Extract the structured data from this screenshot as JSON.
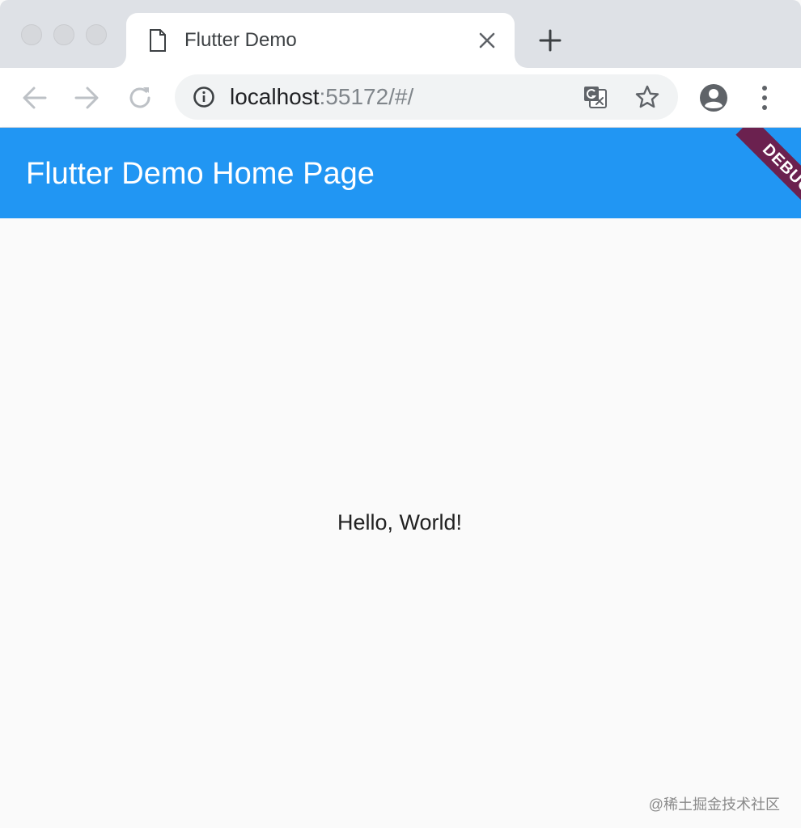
{
  "browser": {
    "tab": {
      "title": "Flutter Demo"
    },
    "address": {
      "host": "localhost",
      "rest": ":55172/#/"
    }
  },
  "icons": {
    "traffic_lights": [
      "close-light",
      "minimize-light",
      "zoom-light"
    ],
    "tab": [
      "document-icon",
      "close-icon"
    ],
    "toolbar": [
      "back-arrow-icon",
      "forward-arrow-icon",
      "reload-icon",
      "info-icon",
      "translate-icon",
      "star-icon",
      "profile-icon",
      "more-vert-icon"
    ]
  },
  "app": {
    "appbar_title": "Flutter Demo Home Page",
    "debug_banner": "DEBUG",
    "body_text": "Hello, World!",
    "accent_color": "#2196f3",
    "banner_color": "#80002a"
  },
  "watermark": "@稀土掘金技术社区"
}
